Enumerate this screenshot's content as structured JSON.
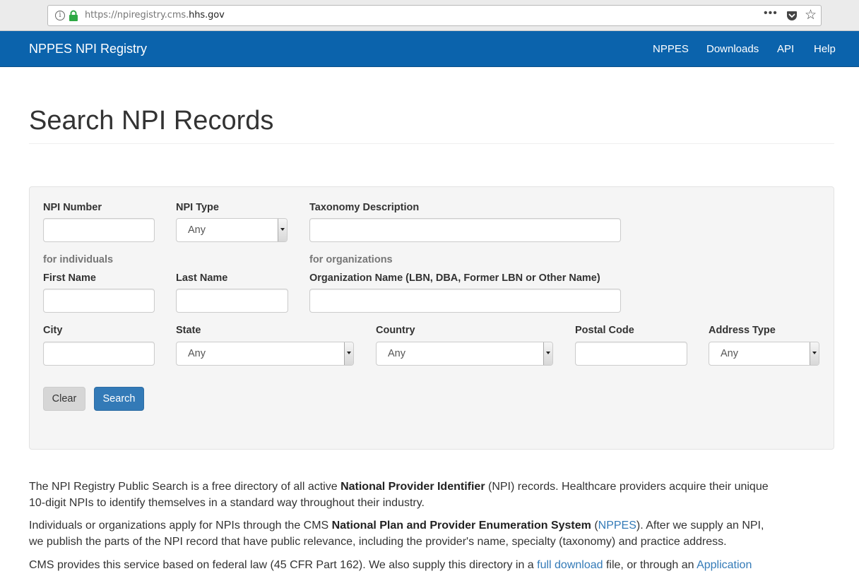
{
  "browser": {
    "url_prefix": "https://npiregistry.cms.",
    "url_domain": "hhs.gov",
    "more_label": "•••"
  },
  "navbar": {
    "brand": "NPPES NPI Registry",
    "links": [
      "NPPES",
      "Downloads",
      "API",
      "Help"
    ]
  },
  "page": {
    "title": "Search NPI Records"
  },
  "form": {
    "npi_number_label": "NPI Number",
    "npi_type_label": "NPI Type",
    "npi_type_value": "Any",
    "taxonomy_label": "Taxonomy Description",
    "individuals_note": "for individuals",
    "organizations_note": "for organizations",
    "first_name_label": "First Name",
    "last_name_label": "Last Name",
    "org_name_label": "Organization Name (LBN, DBA, Former LBN or Other Name)",
    "city_label": "City",
    "state_label": "State",
    "state_value": "Any",
    "country_label": "Country",
    "country_value": "Any",
    "postal_label": "Postal Code",
    "address_type_label": "Address Type",
    "address_type_value": "Any",
    "clear_label": "Clear",
    "search_label": "Search"
  },
  "content": {
    "p1_a": "The NPI Registry Public Search is a free directory of all active ",
    "p1_b": "National Provider Identifier",
    "p1_c": " (NPI) records. Healthcare providers acquire their unique 10-digit NPIs to identify themselves in a standard way throughout their industry.",
    "p2_a": "Individuals or organizations apply for NPIs through the CMS ",
    "p2_b": "National Plan and Provider Enumeration System",
    "p2_c": " (",
    "p2_link": "NPPES",
    "p2_d": "). After we supply an NPI, we publish the parts of the NPI record that have public relevance, including the provider's name, specialty (taxonomy) and practice address.",
    "p3_a": "CMS provides this service based on federal law (45 CFR Part 162). We also supply this directory in a ",
    "p3_link1": "full download",
    "p3_b": " file, or through an ",
    "p3_link2": "Application"
  },
  "colors": {
    "navbar": "#0b63ac",
    "primary_button": "#337ab7",
    "link": "#337ab7",
    "lock": "#2ea844"
  }
}
